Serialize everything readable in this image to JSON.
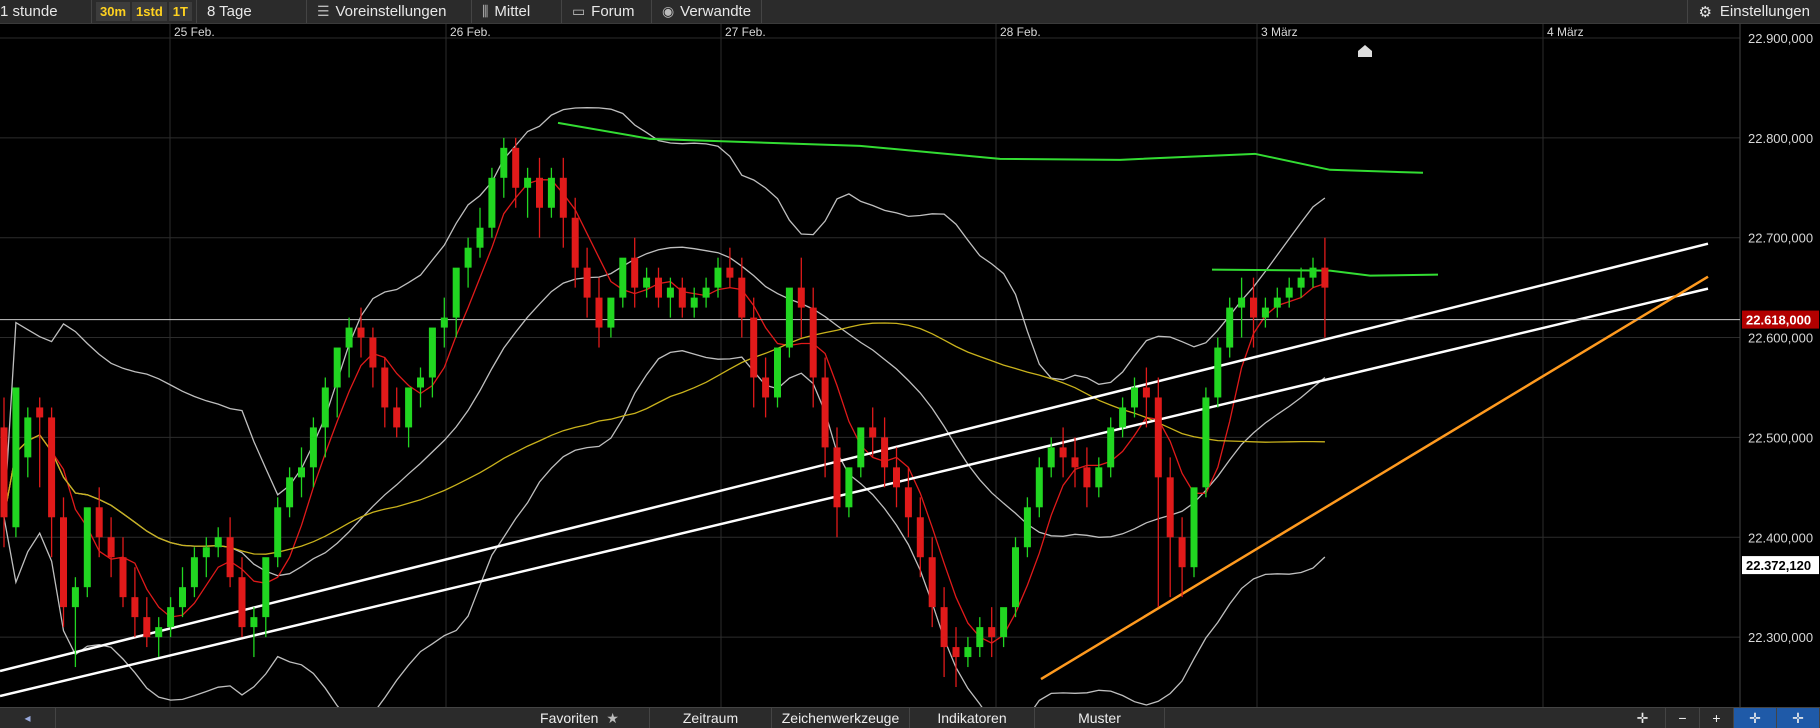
{
  "toolbar": {
    "period": "1 stunde",
    "timeframes": [
      "30m",
      "1std",
      "1T"
    ],
    "range": "8 Tage",
    "presets": "Voreinstellungen",
    "average": "Mittel",
    "forum": "Forum",
    "related": "Verwandte",
    "settings": "Einstellungen"
  },
  "bottom_bar": {
    "favorites": "Favoriten",
    "period": "Zeitraum",
    "drawing_tools": "Zeichenwerkzeuge",
    "indicators": "Indikatoren",
    "patterns": "Muster",
    "zoom_out": "−",
    "zoom_in": "+"
  },
  "colors": {
    "up": "#21d621",
    "down": "#e01a1a",
    "price_tag": "#b30000",
    "mid_line": "#e01a1a",
    "sma": "#c9b21c",
    "bands": "#bfbfbf",
    "resistance": "#33dd33",
    "trend": "#ffffff",
    "support": "#ff9a1f"
  },
  "chart_data": {
    "type": "candlestick",
    "x_labels": [
      "25 Feb.",
      "26 Feb.",
      "27 Feb.",
      "28 Feb.",
      "3 März",
      "4 März"
    ],
    "y_ticks": [
      "22.300,000",
      "22.400,000",
      "22.500,000",
      "22.600,000",
      "22.700,000",
      "22.800,000",
      "22.900,000"
    ],
    "ylim": [
      22230,
      22900
    ],
    "last_price": "22.618,000",
    "marker_price": "22.372,120",
    "grid": true,
    "candles": [
      [
        22510,
        22540,
        22420,
        22390
      ],
      [
        22410,
        22480,
        22550,
        22400
      ],
      [
        22480,
        22530,
        22520,
        22460
      ],
      [
        22530,
        22540,
        22520,
        22450
      ],
      [
        22520,
        22530,
        22420,
        22380
      ],
      [
        22420,
        22440,
        22330,
        22310
      ],
      [
        22330,
        22360,
        22350,
        22270
      ],
      [
        22350,
        22420,
        22430,
        22340
      ],
      [
        22430,
        22450,
        22400,
        22380
      ],
      [
        22400,
        22420,
        22380,
        22360
      ],
      [
        22380,
        22400,
        22340,
        22330
      ],
      [
        22340,
        22370,
        22320,
        22300
      ],
      [
        22320,
        22340,
        22300,
        22290
      ],
      [
        22300,
        22320,
        22310,
        22280
      ],
      [
        22310,
        22340,
        22330,
        22300
      ],
      [
        22330,
        22370,
        22350,
        22320
      ],
      [
        22350,
        22390,
        22380,
        22340
      ],
      [
        22380,
        22400,
        22390,
        22360
      ],
      [
        22390,
        22410,
        22400,
        22380
      ],
      [
        22400,
        22420,
        22360,
        22350
      ],
      [
        22360,
        22380,
        22310,
        22300
      ],
      [
        22310,
        22330,
        22320,
        22280
      ],
      [
        22320,
        22360,
        22380,
        22300
      ],
      [
        22380,
        22440,
        22430,
        22370
      ],
      [
        22430,
        22470,
        22460,
        22420
      ],
      [
        22460,
        22490,
        22470,
        22440
      ],
      [
        22470,
        22520,
        22510,
        22450
      ],
      [
        22510,
        22560,
        22550,
        22480
      ],
      [
        22550,
        22580,
        22590,
        22520
      ],
      [
        22590,
        22620,
        22610,
        22560
      ],
      [
        22610,
        22630,
        22600,
        22580
      ],
      [
        22600,
        22610,
        22570,
        22550
      ],
      [
        22570,
        22580,
        22530,
        22510
      ],
      [
        22530,
        22550,
        22510,
        22500
      ],
      [
        22510,
        22530,
        22550,
        22490
      ],
      [
        22550,
        22570,
        22560,
        22530
      ],
      [
        22560,
        22590,
        22610,
        22540
      ],
      [
        22610,
        22640,
        22620,
        22590
      ],
      [
        22620,
        22640,
        22670,
        22600
      ],
      [
        22670,
        22700,
        22690,
        22650
      ],
      [
        22690,
        22730,
        22710,
        22680
      ],
      [
        22710,
        22770,
        22760,
        22700
      ],
      [
        22760,
        22800,
        22790,
        22740
      ],
      [
        22790,
        22800,
        22750,
        22730
      ],
      [
        22750,
        22770,
        22760,
        22720
      ],
      [
        22760,
        22780,
        22730,
        22700
      ],
      [
        22730,
        22770,
        22760,
        22720
      ],
      [
        22760,
        22780,
        22720,
        22690
      ],
      [
        22720,
        22740,
        22670,
        22650
      ],
      [
        22670,
        22690,
        22640,
        22620
      ],
      [
        22640,
        22660,
        22610,
        22590
      ],
      [
        22610,
        22630,
        22640,
        22600
      ],
      [
        22640,
        22670,
        22680,
        22630
      ],
      [
        22680,
        22700,
        22650,
        22630
      ],
      [
        22650,
        22670,
        22660,
        22640
      ],
      [
        22660,
        22670,
        22640,
        22630
      ],
      [
        22640,
        22660,
        22650,
        22620
      ],
      [
        22650,
        22660,
        22630,
        22620
      ],
      [
        22630,
        22650,
        22640,
        22620
      ],
      [
        22640,
        22660,
        22650,
        22630
      ],
      [
        22650,
        22680,
        22670,
        22640
      ],
      [
        22670,
        22690,
        22660,
        22650
      ],
      [
        22660,
        22680,
        22620,
        22600
      ],
      [
        22620,
        22640,
        22560,
        22530
      ],
      [
        22560,
        22580,
        22540,
        22520
      ],
      [
        22540,
        22560,
        22590,
        22530
      ],
      [
        22590,
        22620,
        22650,
        22580
      ],
      [
        22650,
        22680,
        22630,
        22600
      ],
      [
        22630,
        22650,
        22560,
        22530
      ],
      [
        22560,
        22580,
        22490,
        22460
      ],
      [
        22490,
        22510,
        22430,
        22400
      ],
      [
        22430,
        22450,
        22470,
        22420
      ],
      [
        22470,
        22500,
        22510,
        22460
      ],
      [
        22510,
        22530,
        22500,
        22480
      ],
      [
        22500,
        22520,
        22470,
        22450
      ],
      [
        22470,
        22490,
        22450,
        22430
      ],
      [
        22450,
        22470,
        22420,
        22400
      ],
      [
        22420,
        22440,
        22380,
        22360
      ],
      [
        22380,
        22400,
        22330,
        22310
      ],
      [
        22330,
        22350,
        22290,
        22260
      ],
      [
        22290,
        22310,
        22280,
        22250
      ],
      [
        22280,
        22300,
        22290,
        22270
      ],
      [
        22290,
        22320,
        22310,
        22280
      ],
      [
        22310,
        22330,
        22300,
        22280
      ],
      [
        22300,
        22320,
        22330,
        22290
      ],
      [
        22330,
        22400,
        22390,
        22320
      ],
      [
        22390,
        22440,
        22430,
        22380
      ],
      [
        22430,
        22480,
        22470,
        22420
      ],
      [
        22470,
        22500,
        22490,
        22460
      ],
      [
        22490,
        22510,
        22480,
        22460
      ],
      [
        22480,
        22500,
        22470,
        22450
      ],
      [
        22470,
        22490,
        22450,
        22430
      ],
      [
        22450,
        22480,
        22470,
        22440
      ],
      [
        22470,
        22520,
        22510,
        22460
      ],
      [
        22510,
        22540,
        22530,
        22500
      ],
      [
        22530,
        22560,
        22550,
        22520
      ],
      [
        22550,
        22570,
        22540,
        22510
      ],
      [
        22540,
        22560,
        22460,
        22330
      ],
      [
        22460,
        22480,
        22400,
        22340
      ],
      [
        22400,
        22420,
        22370,
        22340
      ],
      [
        22370,
        22390,
        22450,
        22360
      ],
      [
        22450,
        22550,
        22540,
        22440
      ],
      [
        22540,
        22600,
        22590,
        22530
      ],
      [
        22590,
        22640,
        22630,
        22580
      ],
      [
        22630,
        22660,
        22640,
        22600
      ],
      [
        22640,
        22660,
        22620,
        22590
      ],
      [
        22620,
        22640,
        22630,
        22610
      ],
      [
        22630,
        22650,
        22640,
        22620
      ],
      [
        22640,
        22660,
        22650,
        22630
      ],
      [
        22650,
        22670,
        22660,
        22640
      ],
      [
        22660,
        22680,
        22670,
        22650
      ],
      [
        22670,
        22700,
        22650,
        22600
      ]
    ]
  }
}
